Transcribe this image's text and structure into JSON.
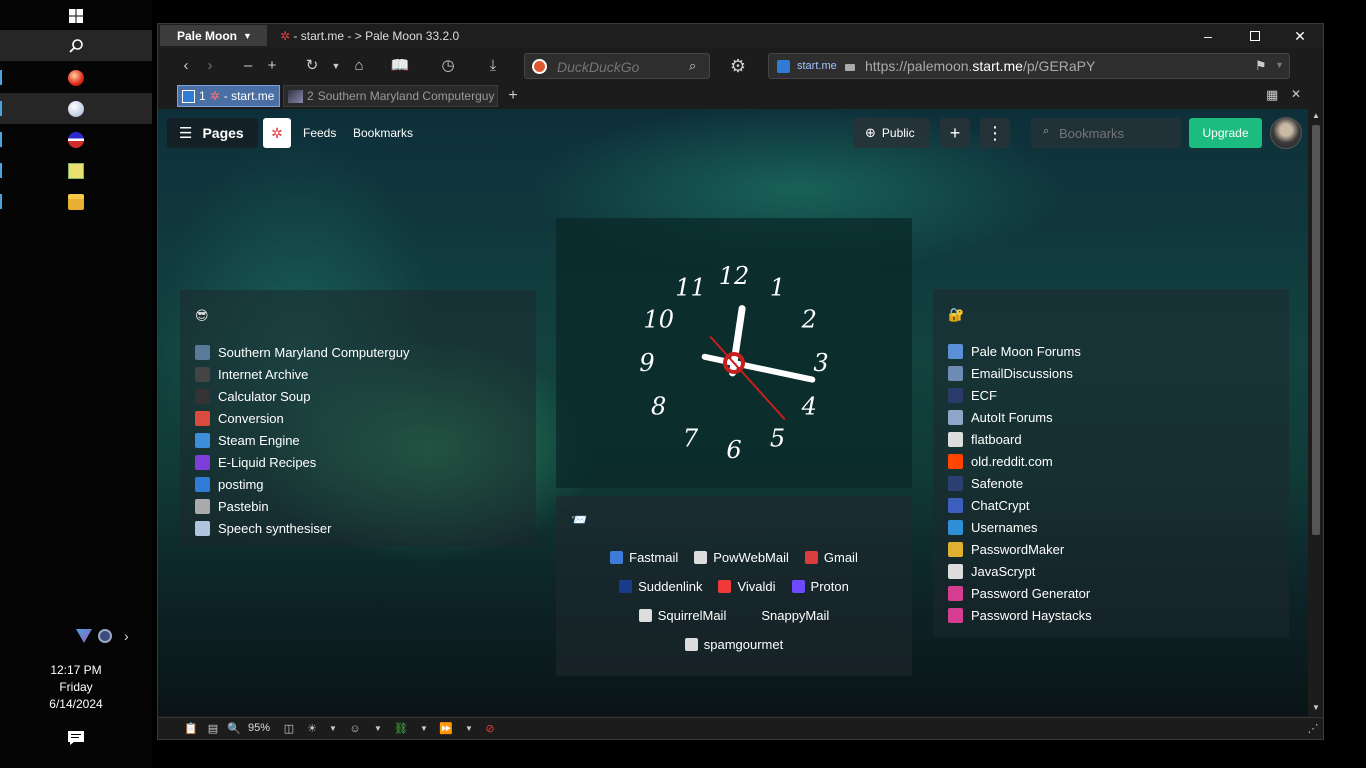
{
  "taskbar": {
    "clock_time": "12:17 PM",
    "clock_day": "Friday",
    "clock_date": "6/14/2024"
  },
  "browser": {
    "app_menu_label": "Pale Moon",
    "window_title": "- start.me - > Pale Moon 33.2.0",
    "search_placeholder": "DuckDuckGo",
    "url_site_label": "start.me",
    "url_prefix": "https://palemoon.",
    "url_domain": "start.me",
    "url_path": "/p/GERaPY",
    "tabs": [
      {
        "number": "1",
        "label": "- start.me"
      },
      {
        "number": "2",
        "label": "Southern Maryland Computerguy"
      }
    ],
    "zoom": "95%"
  },
  "startme": {
    "pages_label": "Pages",
    "feeds_label": "Feeds",
    "bookmarks_label": "Bookmarks",
    "public_label": "Public",
    "search_placeholder": "Bookmarks",
    "upgrade_label": "Upgrade"
  },
  "left_widget": {
    "emoji": "😎",
    "links": [
      {
        "label": "Southern Maryland Computerguy",
        "color": "#5a7a9a"
      },
      {
        "label": "Internet Archive",
        "color": "#444444"
      },
      {
        "label": "Calculator Soup",
        "color": "#333333"
      },
      {
        "label": "Conversion",
        "color": "#d94b3d"
      },
      {
        "label": "Steam Engine",
        "color": "#3d8fd9"
      },
      {
        "label": "E-Liquid Recipes",
        "color": "#7d3dd9"
      },
      {
        "label": "postimg",
        "color": "#2f7bd6"
      },
      {
        "label": "Pastebin",
        "color": "#aaaaaa"
      },
      {
        "label": "Speech synthesiser",
        "color": "#b0c4de"
      }
    ]
  },
  "right_widget": {
    "emoji": "🔐",
    "links": [
      {
        "label": "Pale Moon Forums",
        "color": "#5b8fd6"
      },
      {
        "label": "EmailDiscussions",
        "color": "#6d8bb5"
      },
      {
        "label": "ECF",
        "color": "#2a3a6a"
      },
      {
        "label": "AutoIt Forums",
        "color": "#8ea6c9"
      },
      {
        "label": "flatboard",
        "color": "#dddddd"
      },
      {
        "label": "old.reddit.com",
        "color": "#ff4500"
      },
      {
        "label": "Safenote",
        "color": "#2b3f70"
      },
      {
        "label": "ChatCrypt",
        "color": "#3c5fbf"
      },
      {
        "label": "Usernames",
        "color": "#2f8fd6"
      },
      {
        "label": "PasswordMaker",
        "color": "#e0b030"
      },
      {
        "label": "JavaScrypt",
        "color": "#dddddd"
      },
      {
        "label": "Password Generator",
        "color": "#d63c8f"
      },
      {
        "label": "Password Haystacks",
        "color": "#d63c8f"
      }
    ]
  },
  "clock_widget": {
    "numerals": [
      "12",
      "1",
      "2",
      "3",
      "4",
      "5",
      "6",
      "7",
      "8",
      "9",
      "10",
      "11"
    ],
    "hour": 12,
    "minute": 17
  },
  "mail_widget": {
    "emoji": "📨",
    "rows": [
      [
        {
          "label": "Fastmail",
          "color": "#3d7bd9"
        },
        {
          "label": "PowWebMail",
          "color": "#dddddd"
        },
        {
          "label": "Gmail",
          "color": "#d93d3d"
        }
      ],
      [
        {
          "label": "Suddenlink",
          "color": "#1a3a8a"
        },
        {
          "label": "Vivaldi",
          "color": "#ef3939"
        },
        {
          "label": "Proton",
          "color": "#6d4aff"
        }
      ],
      [
        {
          "label": "SquirrelMail",
          "color": "#dddddd"
        },
        {
          "label": "SnappyMail",
          "color": ""
        }
      ],
      [
        {
          "label": "spamgourmet",
          "color": "#dddddd"
        }
      ]
    ]
  }
}
